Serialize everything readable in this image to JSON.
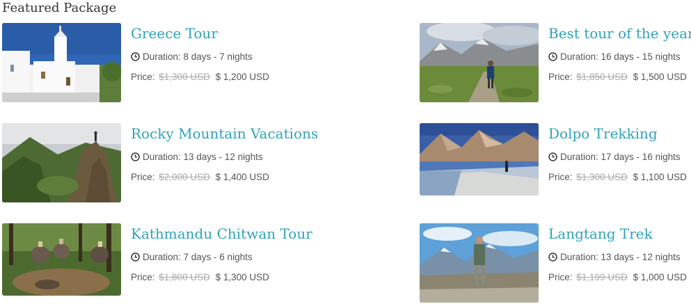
{
  "section": {
    "title": "Featured Package"
  },
  "labels": {
    "price": "Price:"
  },
  "packages": [
    {
      "title": "Greece Tour",
      "duration": "Duration: 8 days - 7 nights",
      "old_price": "$1,300 USD",
      "price": "$ 1,200 USD",
      "image": "greece-church-photo"
    },
    {
      "title": "Best tour of the year",
      "duration": "Duration: 16 days - 15 nights",
      "old_price": "$1,850 USD",
      "price": "$ 1,500 USD",
      "image": "mountain-hiker-photo"
    },
    {
      "title": "Rocky Mountain Vacations",
      "duration": "Duration: 13 days - 12 nights",
      "old_price": "$2,000 USD",
      "price": "$ 1,400 USD",
      "image": "rocky-peak-photo"
    },
    {
      "title": "Dolpo Trekking",
      "duration": "Duration: 17 days - 16 nights",
      "old_price": "$1,300 USD",
      "price": "$ 1,100 USD",
      "image": "dolpo-lake-photo"
    },
    {
      "title": "Kathmandu Chitwan Tour",
      "duration": "Duration: 7 days - 6 nights",
      "old_price": "$1,800 USD",
      "price": "$ 1,300 USD",
      "image": "elephant-safari-photo"
    },
    {
      "title": "Langtang Trek",
      "duration": "Duration: 13 days - 12 nights",
      "old_price": "$1,199 USD",
      "price": "$ 1,000 USD",
      "image": "langtang-hiker-photo"
    }
  ]
}
